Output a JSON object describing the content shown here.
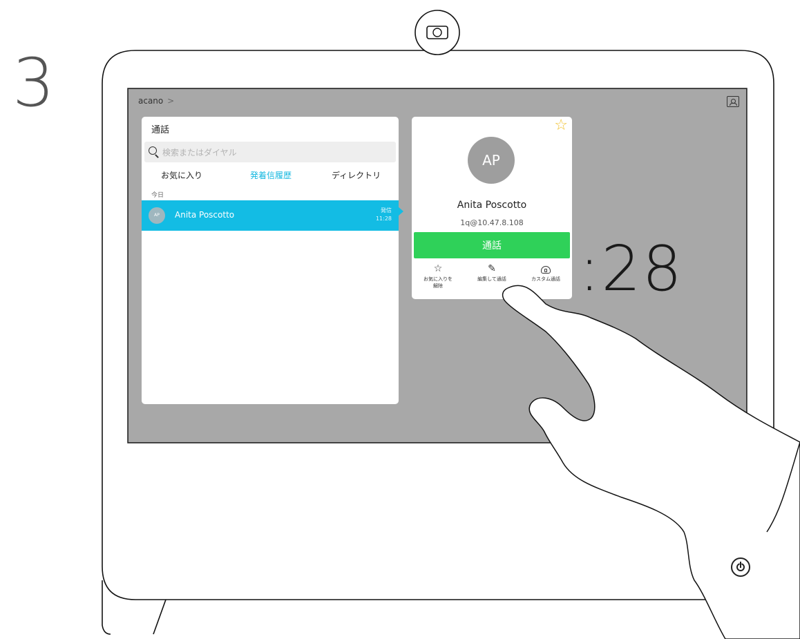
{
  "step": "3",
  "screen": {
    "breadcrumb": "acano",
    "breadcrumb_sep": ">",
    "clock_partial": ":28"
  },
  "panel": {
    "title": "通話",
    "search_placeholder": "検索またはダイヤル",
    "tabs": [
      {
        "label": "お気に入り",
        "active": false
      },
      {
        "label": "発着信履歴",
        "active": true
      },
      {
        "label": "ディレクトリ",
        "active": false
      }
    ],
    "section_label": "今日",
    "rows": [
      {
        "initials": "AP",
        "name": "Anita Poscotto",
        "direction": "発信",
        "time": "11:28",
        "selected": true
      }
    ]
  },
  "card": {
    "initials": "AP",
    "name": "Anita Poscotto",
    "address": "1q@10.47.8.108",
    "call_label": "通話",
    "actions": [
      {
        "icon": "star-outline-icon",
        "label_line1": "お気に入りを",
        "label_line2": "解除"
      },
      {
        "icon": "pencil-icon",
        "label_line1": "編集して通話",
        "label_line2": ""
      },
      {
        "icon": "custom-dial-icon",
        "label_line1": "カスタム通話",
        "label_line2": ""
      }
    ]
  },
  "colors": {
    "accent": "#13bce4",
    "call_green": "#2fd159",
    "favorite_star": "#f1c232",
    "screen_bg": "#a8a8a8"
  }
}
